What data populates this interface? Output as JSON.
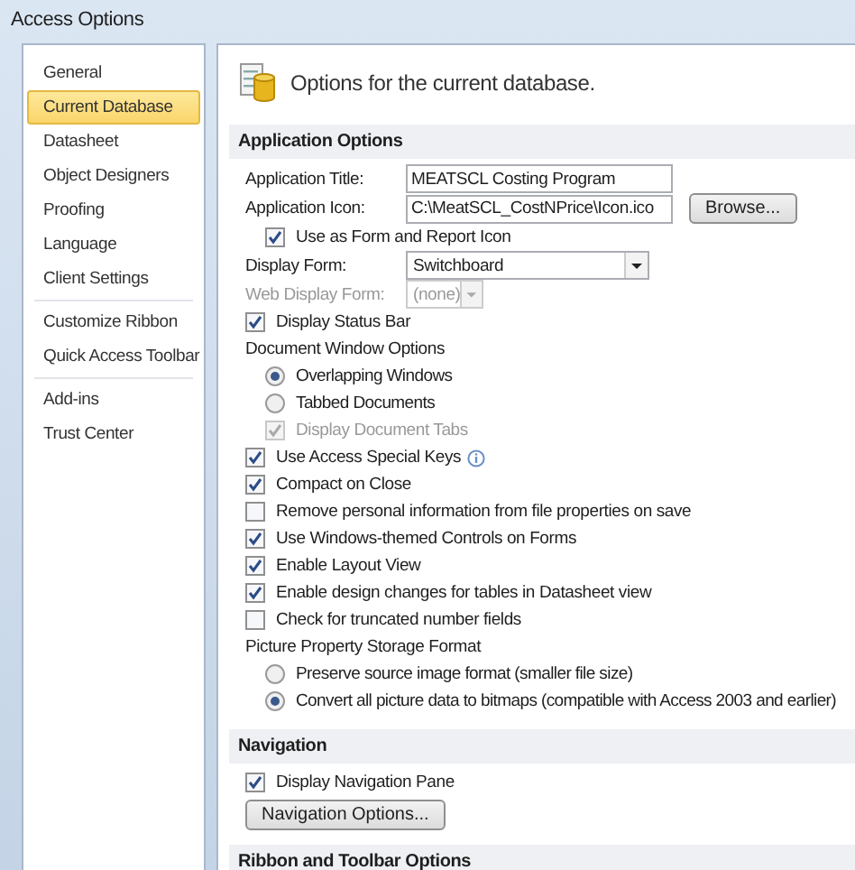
{
  "window": {
    "title": "Access Options"
  },
  "sidebar": {
    "items": [
      {
        "label": "General",
        "selected": false,
        "divider_after": false
      },
      {
        "label": "Current Database",
        "selected": true,
        "divider_after": false
      },
      {
        "label": "Datasheet",
        "selected": false,
        "divider_after": false
      },
      {
        "label": "Object Designers",
        "selected": false,
        "divider_after": false
      },
      {
        "label": "Proofing",
        "selected": false,
        "divider_after": false
      },
      {
        "label": "Language",
        "selected": false,
        "divider_after": false
      },
      {
        "label": "Client Settings",
        "selected": false,
        "divider_after": true
      },
      {
        "label": "Customize Ribbon",
        "selected": false,
        "divider_after": false
      },
      {
        "label": "Quick Access Toolbar",
        "selected": false,
        "divider_after": true
      },
      {
        "label": "Add-ins",
        "selected": false,
        "divider_after": false
      },
      {
        "label": "Trust Center",
        "selected": false,
        "divider_after": false
      }
    ]
  },
  "header": {
    "text": "Options for the current database."
  },
  "sections": [
    {
      "title": "Application Options",
      "items": [
        {
          "kind": "field",
          "label": "Application Title:",
          "value": "MEATSCL Costing Program"
        },
        {
          "kind": "field",
          "label": "Application Icon:",
          "value": "C:\\MeatSCL_CostNPrice\\Icon.ico",
          "button": "Browse...",
          "children": [
            {
              "kind": "checkbox",
              "label": "Use as Form and Report Icon",
              "checked": true,
              "disabled": false
            }
          ]
        },
        {
          "kind": "select",
          "label": "Display Form:",
          "value": "Switchboard",
          "disabled": false
        },
        {
          "kind": "select",
          "label": "Web Display Form:",
          "value": "(none)",
          "disabled": true
        },
        {
          "kind": "checkbox",
          "label": "Display Status Bar",
          "checked": true,
          "disabled": false
        },
        {
          "kind": "heading",
          "label": "Document Window Options",
          "children": [
            {
              "kind": "radio",
              "label": "Overlapping Windows",
              "selected": true
            },
            {
              "kind": "radio",
              "label": "Tabbed Documents",
              "selected": false
            },
            {
              "kind": "checkbox",
              "label": "Display Document Tabs",
              "checked": true,
              "disabled": true
            }
          ]
        },
        {
          "kind": "checkbox",
          "label": "Use Access Special Keys",
          "checked": true,
          "disabled": false,
          "info": true
        },
        {
          "kind": "checkbox",
          "label": "Compact on Close",
          "checked": true,
          "disabled": false
        },
        {
          "kind": "checkbox",
          "label": "Remove personal information from file properties on save",
          "checked": false,
          "disabled": false
        },
        {
          "kind": "checkbox",
          "label": "Use Windows-themed Controls on Forms",
          "checked": true,
          "disabled": false
        },
        {
          "kind": "checkbox",
          "label": "Enable Layout View",
          "checked": true,
          "disabled": false
        },
        {
          "kind": "checkbox",
          "label": "Enable design changes for tables in Datasheet view",
          "checked": true,
          "disabled": false
        },
        {
          "kind": "checkbox",
          "label": "Check for truncated number fields",
          "checked": false,
          "disabled": false
        },
        {
          "kind": "heading",
          "label": "Picture Property Storage Format",
          "children": [
            {
              "kind": "radio",
              "label": "Preserve source image format (smaller file size)",
              "selected": false
            },
            {
              "kind": "radio",
              "label": "Convert all picture data to bitmaps (compatible with Access 2003 and earlier)",
              "selected": true
            }
          ]
        }
      ]
    },
    {
      "title": "Navigation",
      "items": [
        {
          "kind": "checkbox",
          "label": "Display Navigation Pane",
          "checked": true,
          "disabled": false
        },
        {
          "kind": "button",
          "label": "Navigation Options..."
        }
      ]
    },
    {
      "title": "Ribbon and Toolbar Options"
    }
  ]
}
